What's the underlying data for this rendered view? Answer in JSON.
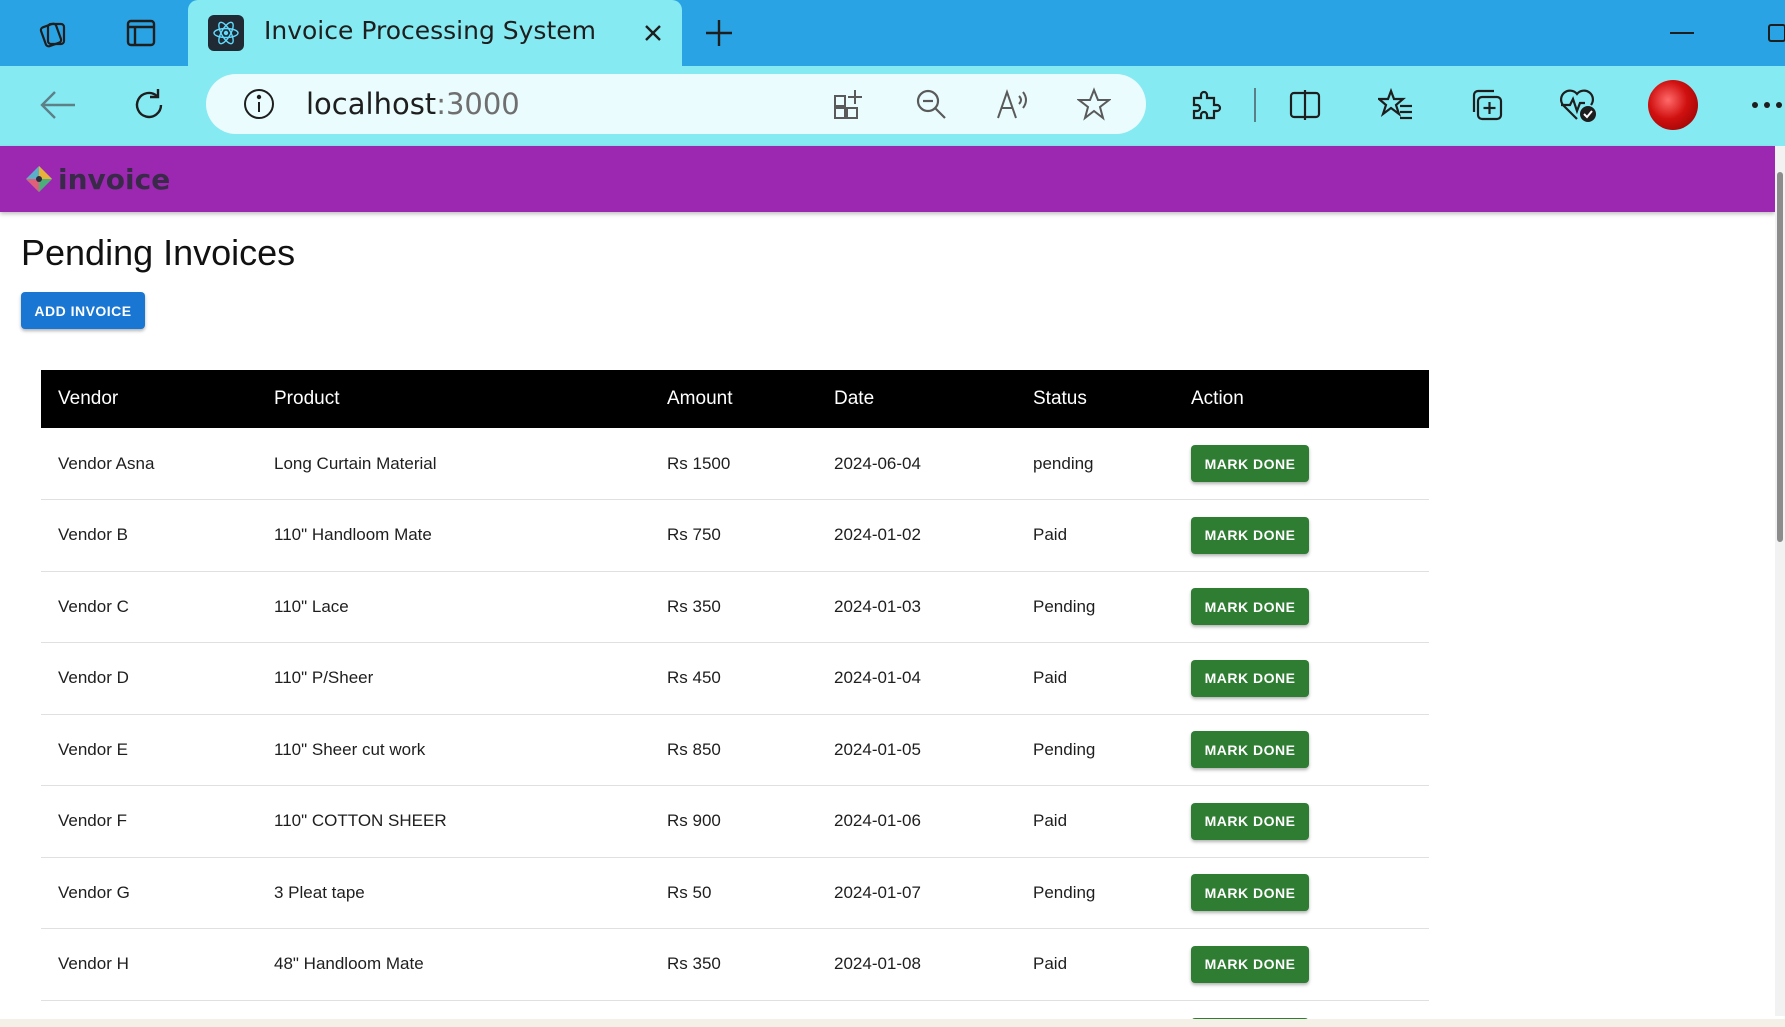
{
  "browser": {
    "tab_title": "Invoice Processing System",
    "address_host": "localhost",
    "address_port": ":3000"
  },
  "app": {
    "logo_text": "invoice",
    "page_title": "Pending Invoices",
    "add_button_label": "ADD INVOICE"
  },
  "table": {
    "headers": [
      "Vendor",
      "Product",
      "Amount",
      "Date",
      "Status",
      "Action"
    ],
    "action_label": "MARK DONE",
    "rows": [
      {
        "vendor": "Vendor Asna",
        "product": "Long Curtain Material",
        "amount": "Rs 1500",
        "date": "2024-06-04",
        "status": "pending"
      },
      {
        "vendor": "Vendor B",
        "product": "110\" Handloom Mate",
        "amount": "Rs 750",
        "date": "2024-01-02",
        "status": "Paid"
      },
      {
        "vendor": "Vendor C",
        "product": "110\" Lace",
        "amount": "Rs 350",
        "date": "2024-01-03",
        "status": "Pending"
      },
      {
        "vendor": "Vendor D",
        "product": "110\" P/Sheer",
        "amount": "Rs 450",
        "date": "2024-01-04",
        "status": "Paid"
      },
      {
        "vendor": "Vendor E",
        "product": "110\" Sheer cut work",
        "amount": "Rs 850",
        "date": "2024-01-05",
        "status": "Pending"
      },
      {
        "vendor": "Vendor F",
        "product": "110\" COTTON SHEER",
        "amount": "Rs 900",
        "date": "2024-01-06",
        "status": "Paid"
      },
      {
        "vendor": "Vendor G",
        "product": "3 Pleat tape",
        "amount": "Rs 50",
        "date": "2024-01-07",
        "status": "Pending"
      },
      {
        "vendor": "Vendor H",
        "product": "48\" Handloom Mate",
        "amount": "Rs 350",
        "date": "2024-01-08",
        "status": "Paid"
      }
    ]
  },
  "colors": {
    "tabbar": "#2aa3e4",
    "toolbar": "#86eaf2",
    "appbar": "#9c27b0",
    "primary_button": "#1976d2",
    "success_button": "#2e7d32"
  },
  "icons": {
    "tabbar": [
      "workspaces-icon",
      "tab-actions-icon",
      "react-icon",
      "close-icon",
      "plus-icon",
      "minimize-icon",
      "maximize-icon"
    ],
    "toolbar": [
      "back-arrow-icon",
      "refresh-icon",
      "info-icon",
      "app-grid-icon",
      "zoom-out-icon",
      "read-aloud-icon",
      "star-icon",
      "extensions-icon",
      "split-screen-icon",
      "favorites-icon",
      "collections-icon",
      "browser-essentials-icon",
      "profile-avatar",
      "more-icon"
    ]
  }
}
